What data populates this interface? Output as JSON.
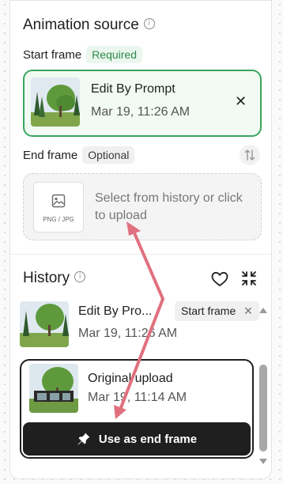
{
  "source": {
    "title": "Animation source",
    "start_frame": {
      "label": "Start frame",
      "badge": "Required",
      "card": {
        "title": "Edit By Prompt",
        "date": "Mar 19, 11:26 AM"
      }
    },
    "end_frame": {
      "label": "End frame",
      "badge": "Optional",
      "upload_ext": "PNG / JPG",
      "upload_text": "Select from history or click to upload"
    }
  },
  "history": {
    "title": "History",
    "items": [
      {
        "title": "Edit By Pro...",
        "date": "Mar 19, 11:26 AM",
        "badge": "Start frame"
      },
      {
        "title": "Original upload",
        "date": "Mar 19, 11:14 AM",
        "action": "Use as end frame"
      }
    ]
  },
  "colors": {
    "accent_green": "#3aa65e",
    "annotation_arrow": "#e0707e",
    "button_dark": "#1f1f1f"
  }
}
